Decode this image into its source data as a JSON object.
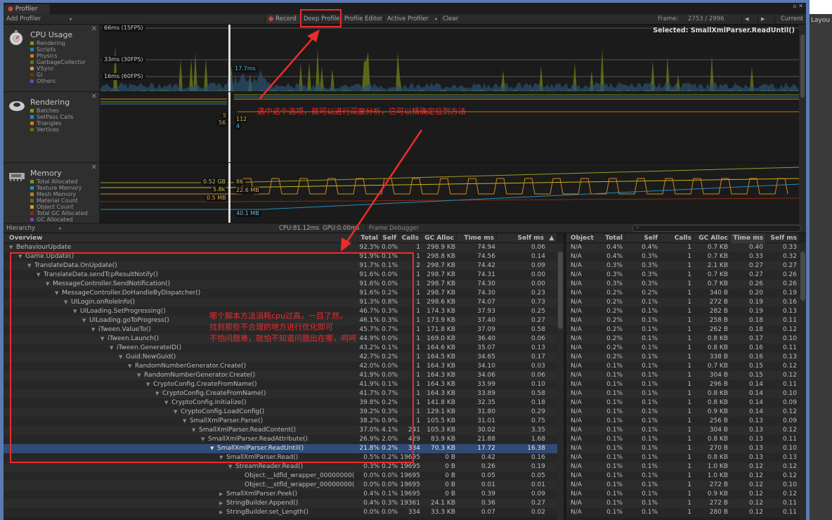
{
  "window": {
    "tab": "Profiler",
    "controls": "▫ ✕"
  },
  "toolbar": {
    "add_profiler": "Add Profiler",
    "record": "Record",
    "deep_profile": "Deep Profile",
    "profile_editor": "Profile Editor",
    "active_profiler": "Active Profiler",
    "clear": "Clear",
    "frame_label": "Frame:",
    "frame_value": "2753 / 2996",
    "current": "Current"
  },
  "cpu": {
    "title": "CPU Usage",
    "legend": [
      {
        "label": "Rendering",
        "color": "#7a9a1a"
      },
      {
        "label": "Scripts",
        "color": "#2a7ab0"
      },
      {
        "label": "Physics",
        "color": "#d07818"
      },
      {
        "label": "GarbageCollector",
        "color": "#6a6a18"
      },
      {
        "label": "VSync",
        "color": "#c8a818"
      },
      {
        "label": "Gi",
        "color": "#8a2a10"
      },
      {
        "label": "Others",
        "color": "#6a4aa8"
      }
    ],
    "gridlines": [
      "66ms (15FPS)",
      "33ms (30FPS)",
      "16ms (60FPS)"
    ],
    "cursor_value": "17.7ms",
    "selected": "Selected: SmallXmlParser.ReadUntil()"
  },
  "rendering": {
    "title": "Rendering",
    "legend": [
      {
        "label": "Batches",
        "color": "#7a9a1a"
      },
      {
        "label": "SetPass Calls",
        "color": "#2a8ab8"
      },
      {
        "label": "Triangles",
        "color": "#d07818"
      },
      {
        "label": "Vertices",
        "color": "#6a6a18"
      }
    ],
    "values": [
      "5",
      "56",
      "112",
      "4"
    ]
  },
  "memory": {
    "title": "Memory",
    "legend": [
      {
        "label": "Total Allocated",
        "color": "#7a9a1a"
      },
      {
        "label": "Texture Memory",
        "color": "#2a8ab8"
      },
      {
        "label": "Mesh Memory",
        "color": "#d07818"
      },
      {
        "label": "Material Count",
        "color": "#6a6a18"
      },
      {
        "label": "Object Count",
        "color": "#c8a818"
      },
      {
        "label": "Total GC Allocated",
        "color": "#8a2a10"
      },
      {
        "label": "GC Allocated",
        "color": "#6a4aa8"
      }
    ],
    "values": [
      "0.52 GB",
      "5.8k",
      "0.5 MB",
      "86",
      "22.6 MB",
      "40.1 MB"
    ]
  },
  "hierarchy_bar": {
    "mode": "Hierarchy",
    "cpu": "CPU:81.12ms",
    "gpu": "GPU:0.00ms",
    "frame_debugger": "Frame Debugger"
  },
  "left_table": {
    "columns": [
      "Overview",
      "Total",
      "Self",
      "Calls",
      "GC Alloc",
      "Time ms",
      "Self ms"
    ],
    "rows": [
      {
        "name": "BehaviourUpdate",
        "depth": 0,
        "expand": "open",
        "total": "92.3%",
        "self": "0.0%",
        "calls": "1",
        "gc": "298.9 KB",
        "time": "74.94",
        "selfms": "0.06"
      },
      {
        "name": "Game.Update()",
        "depth": 1,
        "expand": "open",
        "total": "91.9%",
        "self": "0.1%",
        "calls": "1",
        "gc": "298.8 KB",
        "time": "74.56",
        "selfms": "0.14"
      },
      {
        "name": "TranslateData.OnUpdate()",
        "depth": 2,
        "expand": "open",
        "total": "91.7%",
        "self": "0.1%",
        "calls": "2",
        "gc": "298.7 KB",
        "time": "74.42",
        "selfms": "0.09"
      },
      {
        "name": "TranslateData.sendTcpResultNotify()",
        "depth": 3,
        "expand": "open",
        "total": "91.6%",
        "self": "0.0%",
        "calls": "1",
        "gc": "298.7 KB",
        "time": "74.31",
        "selfms": "0.00"
      },
      {
        "name": "MessageController.SendNotification()",
        "depth": 4,
        "expand": "open",
        "total": "91.6%",
        "self": "0.0%",
        "calls": "1",
        "gc": "298.7 KB",
        "time": "74.30",
        "selfms": "0.00"
      },
      {
        "name": "MessageController.DoHandleByDispatcher()",
        "depth": 5,
        "expand": "open",
        "total": "91.6%",
        "self": "0.2%",
        "calls": "1",
        "gc": "298.7 KB",
        "time": "74.30",
        "selfms": "0.23"
      },
      {
        "name": "UILogin.onRoleInfo()",
        "depth": 6,
        "expand": "open",
        "total": "91.3%",
        "self": "0.8%",
        "calls": "1",
        "gc": "298.6 KB",
        "time": "74.07",
        "selfms": "0.73"
      },
      {
        "name": "UILoading.SetProgressing()",
        "depth": 7,
        "expand": "open",
        "total": "46.7%",
        "self": "0.3%",
        "calls": "1",
        "gc": "174.3 KB",
        "time": "37.93",
        "selfms": "0.25"
      },
      {
        "name": "UILoading.goToProgress()",
        "depth": 8,
        "expand": "open",
        "total": "46.1%",
        "self": "0.3%",
        "calls": "1",
        "gc": "173.9 KB",
        "time": "37.40",
        "selfms": "0.27"
      },
      {
        "name": "iTween.ValueTo()",
        "depth": 9,
        "expand": "open",
        "total": "45.7%",
        "self": "0.7%",
        "calls": "1",
        "gc": "171.8 KB",
        "time": "37.09",
        "selfms": "0.58"
      },
      {
        "name": "iTween.Launch()",
        "depth": 10,
        "expand": "open",
        "total": "44.9%",
        "self": "0.0%",
        "calls": "1",
        "gc": "169.0 KB",
        "time": "36.40",
        "selfms": "0.06"
      },
      {
        "name": "iTween.GenerateID()",
        "depth": 11,
        "expand": "open",
        "total": "43.2%",
        "self": "0.1%",
        "calls": "1",
        "gc": "164.6 KB",
        "time": "35.07",
        "selfms": "0.13"
      },
      {
        "name": "Guid.NewGuid()",
        "depth": 12,
        "expand": "open",
        "total": "42.7%",
        "self": "0.2%",
        "calls": "1",
        "gc": "164.5 KB",
        "time": "34.65",
        "selfms": "0.17"
      },
      {
        "name": "RandomNumberGenerator.Create()",
        "depth": 13,
        "expand": "open",
        "total": "42.0%",
        "self": "0.0%",
        "calls": "1",
        "gc": "164.3 KB",
        "time": "34.10",
        "selfms": "0.03"
      },
      {
        "name": "RandomNumberGenerator.Create()",
        "depth": 14,
        "expand": "open",
        "total": "41.9%",
        "self": "0.0%",
        "calls": "1",
        "gc": "164.3 KB",
        "time": "34.06",
        "selfms": "0.06"
      },
      {
        "name": "CryptoConfig.CreateFromName()",
        "depth": 15,
        "expand": "open",
        "total": "41.9%",
        "self": "0.1%",
        "calls": "1",
        "gc": "164.3 KB",
        "time": "33.99",
        "selfms": "0.10"
      },
      {
        "name": "CryptoConfig.CreateFromName()",
        "depth": 16,
        "expand": "open",
        "total": "41.7%",
        "self": "0.7%",
        "calls": "1",
        "gc": "164.3 KB",
        "time": "33.89",
        "selfms": "0.58"
      },
      {
        "name": "CryptoConfig.Initialize()",
        "depth": 17,
        "expand": "open",
        "total": "39.8%",
        "self": "0.2%",
        "calls": "1",
        "gc": "141.8 KB",
        "time": "32.35",
        "selfms": "0.18"
      },
      {
        "name": "CryptoConfig.LoadConfig()",
        "depth": 18,
        "expand": "open",
        "total": "39.2%",
        "self": "0.3%",
        "calls": "1",
        "gc": "129.1 KB",
        "time": "31.80",
        "selfms": "0.29"
      },
      {
        "name": "SmallXmlParser.Parse()",
        "depth": 19,
        "expand": "open",
        "total": "38.2%",
        "self": "0.9%",
        "calls": "1",
        "gc": "105.5 KB",
        "time": "31.01",
        "selfms": "0.75"
      },
      {
        "name": "SmallXmlParser.ReadContent()",
        "depth": 20,
        "expand": "open",
        "total": "37.0%",
        "self": "4.1%",
        "calls": "241",
        "gc": "105.3 KB",
        "time": "30.02",
        "selfms": "3.35"
      },
      {
        "name": "SmallXmlParser.ReadAttribute()",
        "depth": 21,
        "expand": "open",
        "total": "26.9%",
        "self": "2.0%",
        "calls": "429",
        "gc": "83.9 KB",
        "time": "21.88",
        "selfms": "1.68"
      },
      {
        "name": "SmallXmlParser.ReadUntil()",
        "depth": 22,
        "expand": "open",
        "selected": true,
        "total": "21.8%",
        "self": "0.2%",
        "calls": "334",
        "gc": "70.3 KB",
        "time": "17.72",
        "selfms": "16.38"
      },
      {
        "name": "SmallXmlParser.Read()",
        "depth": 23,
        "expand": "open",
        "total": "0.5%",
        "self": "0.2%",
        "calls": "19695",
        "gc": "0 B",
        "time": "0.42",
        "selfms": "0.16"
      },
      {
        "name": "StreamReader.Read()",
        "depth": 24,
        "expand": "open",
        "total": "0.3%",
        "self": "0.2%",
        "calls": "19695",
        "gc": "0 B",
        "time": "0.26",
        "selfms": "0.19"
      },
      {
        "name": "Object.__ldfld_wrapper_00000000(",
        "depth": 25,
        "expand": "none",
        "total": "0.0%",
        "self": "0.0%",
        "calls": "19695",
        "gc": "0 B",
        "time": "0.05",
        "selfms": "0.05"
      },
      {
        "name": "Object.__stfld_wrapper_00000000(",
        "depth": 25,
        "expand": "none",
        "total": "0.0%",
        "self": "0.0%",
        "calls": "19695",
        "gc": "0 B",
        "time": "0.01",
        "selfms": "0.01"
      },
      {
        "name": "SmallXmlParser.Peek()",
        "depth": 23,
        "expand": "closed",
        "total": "0.4%",
        "self": "0.1%",
        "calls": "19695",
        "gc": "0 B",
        "time": "0.39",
        "selfms": "0.09"
      },
      {
        "name": "StringBuilder.Append()",
        "depth": 23,
        "expand": "closed",
        "total": "0.4%",
        "self": "0.3%",
        "calls": "19361",
        "gc": "24.1 KB",
        "time": "0.36",
        "selfms": "0.27"
      },
      {
        "name": "StringBuilder.set_Length()",
        "depth": 23,
        "expand": "closed",
        "total": "0.0%",
        "self": "0.0%",
        "calls": "334",
        "gc": "33.3 KB",
        "time": "0.07",
        "selfms": "0.02"
      }
    ]
  },
  "right_table": {
    "columns": [
      "Object",
      "Total",
      "Self",
      "Calls",
      "GC Alloc",
      "Time ms",
      "Self ms"
    ],
    "rows": [
      [
        "N/A",
        "0.4%",
        "0.4%",
        "1",
        "0.7 KB",
        "0.40",
        "0.33"
      ],
      [
        "N/A",
        "0.4%",
        "0.3%",
        "1",
        "0.7 KB",
        "0.33",
        "0.32"
      ],
      [
        "N/A",
        "0.3%",
        "0.3%",
        "1",
        "2.1 KB",
        "0.27",
        "0.27"
      ],
      [
        "N/A",
        "0.3%",
        "0.3%",
        "1",
        "0.7 KB",
        "0.27",
        "0.26"
      ],
      [
        "N/A",
        "0.3%",
        "0.3%",
        "1",
        "0.7 KB",
        "0.26",
        "0.26"
      ],
      [
        "N/A",
        "0.2%",
        "0.2%",
        "1",
        "340 B",
        "0.20",
        "0.19"
      ],
      [
        "N/A",
        "0.2%",
        "0.1%",
        "1",
        "272 B",
        "0.19",
        "0.16"
      ],
      [
        "N/A",
        "0.2%",
        "0.1%",
        "1",
        "282 B",
        "0.19",
        "0.13"
      ],
      [
        "N/A",
        "0.2%",
        "0.1%",
        "1",
        "258 B",
        "0.18",
        "0.11"
      ],
      [
        "N/A",
        "0.2%",
        "0.1%",
        "1",
        "262 B",
        "0.18",
        "0.12"
      ],
      [
        "N/A",
        "0.2%",
        "0.1%",
        "1",
        "0.8 KB",
        "0.17",
        "0.10"
      ],
      [
        "N/A",
        "0.2%",
        "0.1%",
        "1",
        "0.8 KB",
        "0.16",
        "0.11"
      ],
      [
        "N/A",
        "0.2%",
        "0.1%",
        "1",
        "338 B",
        "0.16",
        "0.13"
      ],
      [
        "N/A",
        "0.1%",
        "0.1%",
        "1",
        "0.7 KB",
        "0.15",
        "0.12"
      ],
      [
        "N/A",
        "0.1%",
        "0.1%",
        "1",
        "304 B",
        "0.15",
        "0.12"
      ],
      [
        "N/A",
        "0.1%",
        "0.1%",
        "1",
        "296 B",
        "0.14",
        "0.11"
      ],
      [
        "N/A",
        "0.1%",
        "0.1%",
        "1",
        "0.8 KB",
        "0.14",
        "0.10"
      ],
      [
        "N/A",
        "0.1%",
        "0.1%",
        "1",
        "0.8 KB",
        "0.14",
        "0.09"
      ],
      [
        "N/A",
        "0.1%",
        "0.1%",
        "1",
        "0.9 KB",
        "0.14",
        "0.12"
      ],
      [
        "N/A",
        "0.1%",
        "0.1%",
        "1",
        "256 B",
        "0.13",
        "0.09"
      ],
      [
        "N/A",
        "0.1%",
        "0.1%",
        "1",
        "304 B",
        "0.13",
        "0.12"
      ],
      [
        "N/A",
        "0.1%",
        "0.1%",
        "1",
        "0.8 KB",
        "0.13",
        "0.11"
      ],
      [
        "N/A",
        "0.1%",
        "0.1%",
        "1",
        "270 B",
        "0.13",
        "0.10"
      ],
      [
        "N/A",
        "0.1%",
        "0.1%",
        "1",
        "0.8 KB",
        "0.13",
        "0.13"
      ],
      [
        "N/A",
        "0.1%",
        "0.1%",
        "1",
        "1.0 KB",
        "0.12",
        "0.12"
      ],
      [
        "N/A",
        "0.1%",
        "0.1%",
        "1",
        "1.0 KB",
        "0.12",
        "0.12"
      ],
      [
        "N/A",
        "0.1%",
        "0.1%",
        "1",
        "272 B",
        "0.12",
        "0.10"
      ],
      [
        "N/A",
        "0.1%",
        "0.1%",
        "1",
        "0.9 KB",
        "0.12",
        "0.12"
      ],
      [
        "N/A",
        "0.1%",
        "0.1%",
        "1",
        "272 B",
        "0.12",
        "0.11"
      ],
      [
        "N/A",
        "0.1%",
        "0.1%",
        "1",
        "280 B",
        "0.12",
        "0.11"
      ]
    ]
  },
  "annotations": {
    "deep_profile_note": "选中这个选项，就可以进行深度分析，它可以精确定位到方法",
    "hierarchy_note": [
      "哪个脚本方法消耗cpu过高，一目了然，",
      "找到那些不合理的地方进行优化即可",
      "不怕问题难，就怕不知道问题出在哪，呵呵"
    ],
    "color": "#ee2b2b"
  },
  "side_panel": {
    "layout": "Layou"
  }
}
